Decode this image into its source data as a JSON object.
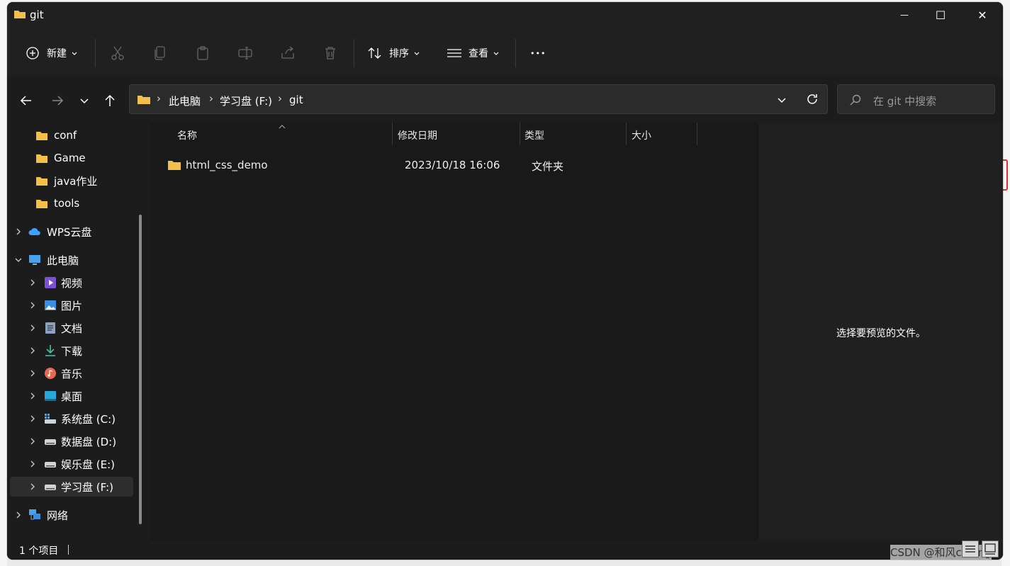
{
  "window": {
    "title": "git"
  },
  "window_controls": {
    "minimize": "—",
    "maximize": "☐",
    "close": "✕"
  },
  "toolbar": {
    "new_label": "新建",
    "sort_label": "排序",
    "view_label": "查看",
    "more_label": "•••"
  },
  "address": {
    "crumbs": [
      "此电脑",
      "学习盘 (F:)",
      "git"
    ],
    "separator": "›"
  },
  "search": {
    "placeholder": "在 git 中搜索"
  },
  "sidebar": {
    "items": [
      {
        "label": "conf"
      },
      {
        "label": "Game"
      },
      {
        "label": "java作业"
      },
      {
        "label": "tools"
      },
      {
        "label": "WPS云盘"
      },
      {
        "label": "此电脑"
      },
      {
        "label": "视频"
      },
      {
        "label": "图片"
      },
      {
        "label": "文档"
      },
      {
        "label": "下载"
      },
      {
        "label": "音乐"
      },
      {
        "label": "桌面"
      },
      {
        "label": "系统盘 (C:)"
      },
      {
        "label": "数据盘 (D:)"
      },
      {
        "label": "娱乐盘 (E:)"
      },
      {
        "label": "学习盘 (F:)"
      },
      {
        "label": "网络"
      }
    ]
  },
  "columns": {
    "name": "名称",
    "modified": "修改日期",
    "type": "类型",
    "size": "大小"
  },
  "files": [
    {
      "name": "html_css_demo",
      "modified": "2023/10/18 16:06",
      "type": "文件夹",
      "size": ""
    }
  ],
  "preview": {
    "message": "选择要预览的文件。"
  },
  "status": {
    "count": "1 个项目"
  },
  "watermark": "CSDN @和风coding",
  "colors": {
    "folder": "#f2c04a",
    "window_bg": "#1c1c1c",
    "preview_bg": "#202020"
  }
}
